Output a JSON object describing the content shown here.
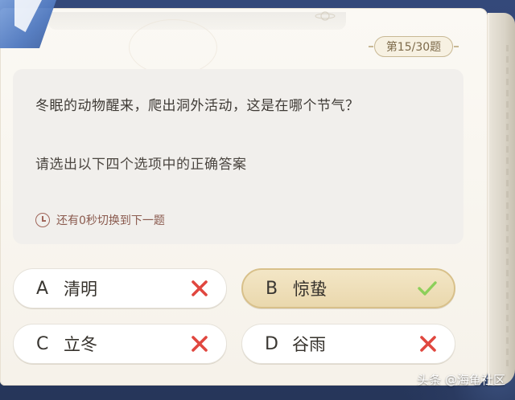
{
  "counter": {
    "label": "第15/30题"
  },
  "question": {
    "text": "冬眠的动物醒来，爬出洞外活动，这是在哪个节气？",
    "instruction": "请选出以下四个选项中的正确答案",
    "timer_text": "还有0秒切换到下一题"
  },
  "options": [
    {
      "letter": "A",
      "text": "清明",
      "state": "wrong",
      "mark_icon": "cross-icon",
      "mark_color": "#e0473f"
    },
    {
      "letter": "B",
      "text": "惊蛰",
      "state": "correct",
      "mark_icon": "check-icon",
      "mark_color": "#8ccf5a"
    },
    {
      "letter": "C",
      "text": "立冬",
      "state": "wrong",
      "mark_icon": "cross-icon",
      "mark_color": "#e0473f"
    },
    {
      "letter": "D",
      "text": "谷雨",
      "state": "wrong",
      "mark_icon": "cross-icon",
      "mark_color": "#e0473f"
    }
  ],
  "watermark": {
    "text": "头条 @海龟社区"
  },
  "colors": {
    "accent_gold": "#c8b894",
    "correct_fill": "#ead8ad",
    "timer_red": "#a0665a",
    "backdrop_blue": "#2d3f66"
  }
}
